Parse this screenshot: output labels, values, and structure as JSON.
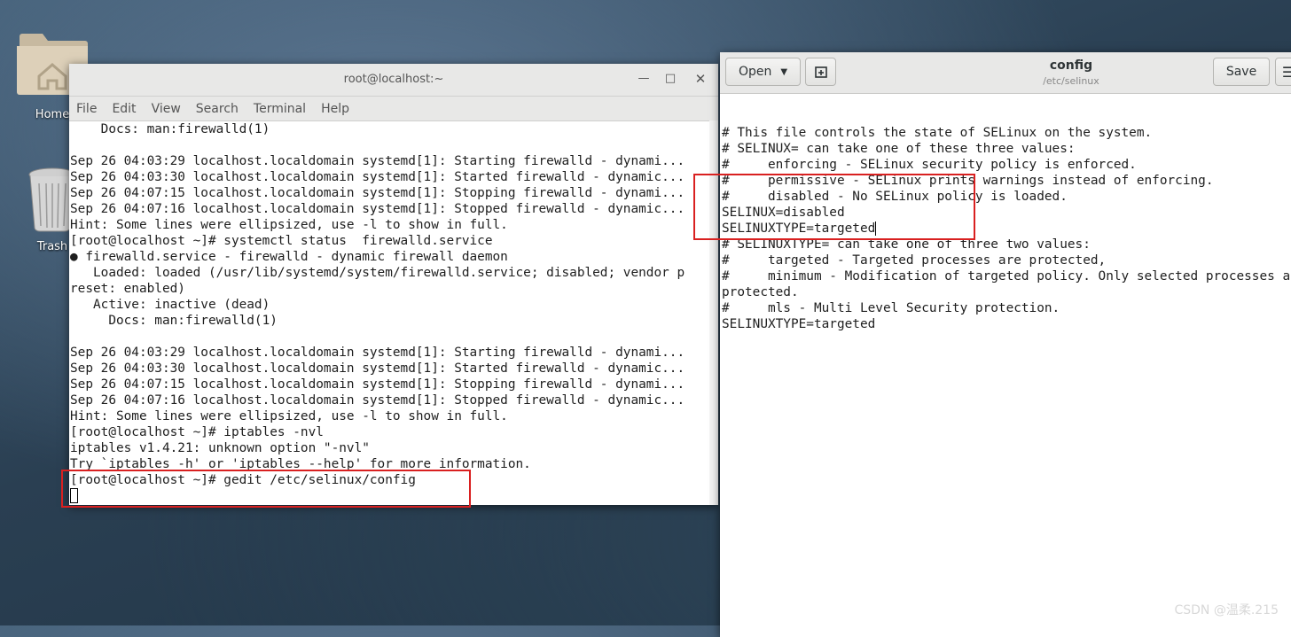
{
  "desktop": {
    "icons": [
      {
        "label": "Home",
        "icon": "folder-home-icon"
      },
      {
        "label": "Trash",
        "icon": "trash-icon"
      }
    ]
  },
  "terminal": {
    "title": "root@localhost:~",
    "menu": [
      "File",
      "Edit",
      "View",
      "Search",
      "Terminal",
      "Help"
    ],
    "lines": [
      "    Docs: man:firewalld(1)",
      "",
      "Sep 26 04:03:29 localhost.localdomain systemd[1]: Starting firewalld - dynami...",
      "Sep 26 04:03:30 localhost.localdomain systemd[1]: Started firewalld - dynamic...",
      "Sep 26 04:07:15 localhost.localdomain systemd[1]: Stopping firewalld - dynami...",
      "Sep 26 04:07:16 localhost.localdomain systemd[1]: Stopped firewalld - dynamic...",
      "Hint: Some lines were ellipsized, use -l to show in full.",
      "[root@localhost ~]# systemctl status  firewalld.service",
      "● firewalld.service - firewalld - dynamic firewall daemon",
      "   Loaded: loaded (/usr/lib/systemd/system/firewalld.service; disabled; vendor p",
      "reset: enabled)",
      "   Active: inactive (dead)",
      "     Docs: man:firewalld(1)",
      "",
      "Sep 26 04:03:29 localhost.localdomain systemd[1]: Starting firewalld - dynami...",
      "Sep 26 04:03:30 localhost.localdomain systemd[1]: Started firewalld - dynamic...",
      "Sep 26 04:07:15 localhost.localdomain systemd[1]: Stopping firewalld - dynami...",
      "Sep 26 04:07:16 localhost.localdomain systemd[1]: Stopped firewalld - dynamic...",
      "Hint: Some lines were ellipsized, use -l to show in full.",
      "[root@localhost ~]# iptables -nvl",
      "iptables v1.4.21: unknown option \"-nvl\"",
      "Try `iptables -h' or 'iptables --help' for more information.",
      "[root@localhost ~]# gedit /etc/selinux/config"
    ]
  },
  "gedit": {
    "open_label": "Open",
    "save_label": "Save",
    "doc_title": "config",
    "doc_path": "/etc/selinux",
    "lines": [
      "",
      "# This file controls the state of SELinux on the system.",
      "# SELINUX= can take one of these three values:",
      "#     enforcing - SELinux security policy is enforced.",
      "#     permissive - SELinux prints warnings instead of enforcing.",
      "#     disabled - No SELinux policy is loaded.",
      "SELINUX=disabled",
      "SELINUXTYPE=targeted",
      "# SELINUXTYPE= can take one of three two values:",
      "#     targeted - Targeted processes are protected,",
      "#     minimum - Modification of targeted policy. Only selected processes are",
      "protected.",
      "#     mls - Multi Level Security protection.",
      "SELINUXTYPE=targeted"
    ]
  },
  "watermark": "CSDN @温柔.215"
}
